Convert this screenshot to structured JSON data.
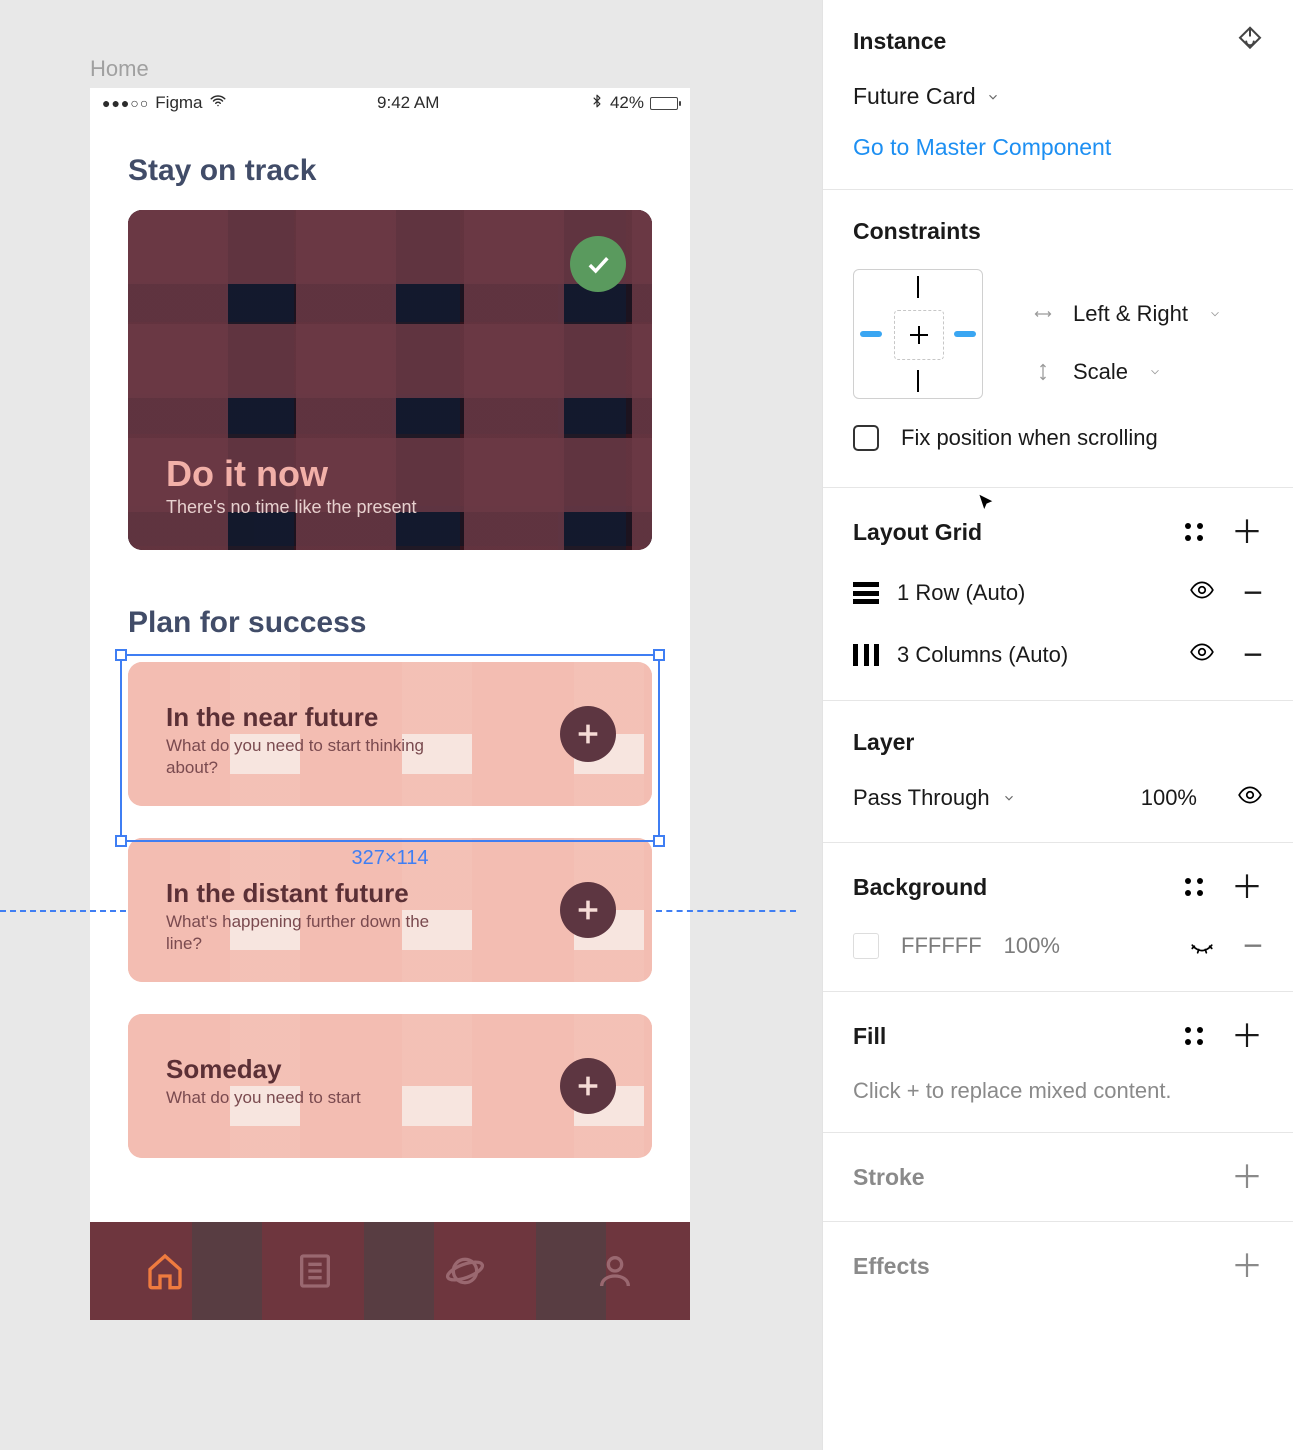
{
  "canvas": {
    "frame_label": "Home",
    "status": {
      "carrier": "Figma",
      "time": "9:42 AM",
      "battery": "42%"
    },
    "section1_title": "Stay on track",
    "card_large": {
      "title": "Do it now",
      "subtitle": "There's no time like the present"
    },
    "section2_title": "Plan for success",
    "cards": [
      {
        "title": "In the near future",
        "subtitle": "What do you need to start thinking about?"
      },
      {
        "title": "In the distant future",
        "subtitle": "What's happening further down the line?"
      },
      {
        "title": "Someday",
        "subtitle": "What do you need to start"
      }
    ],
    "selection_dimensions": "327×114"
  },
  "inspector": {
    "instance": {
      "title": "Instance",
      "name": "Future Card",
      "link": "Go to Master Component"
    },
    "constraints": {
      "title": "Constraints",
      "horizontal": "Left & Right",
      "vertical": "Scale",
      "fix_label": "Fix position when scrolling"
    },
    "layout_grid": {
      "title": "Layout Grid",
      "rows": [
        {
          "label": "1 Row (Auto)"
        },
        {
          "label": "3 Columns (Auto)"
        }
      ]
    },
    "layer": {
      "title": "Layer",
      "blend_mode": "Pass Through",
      "opacity": "100%"
    },
    "background": {
      "title": "Background",
      "hex": "FFFFFF",
      "opacity": "100%"
    },
    "fill": {
      "title": "Fill",
      "message": "Click + to replace mixed content."
    },
    "stroke": {
      "title": "Stroke"
    },
    "effects": {
      "title": "Effects"
    }
  }
}
